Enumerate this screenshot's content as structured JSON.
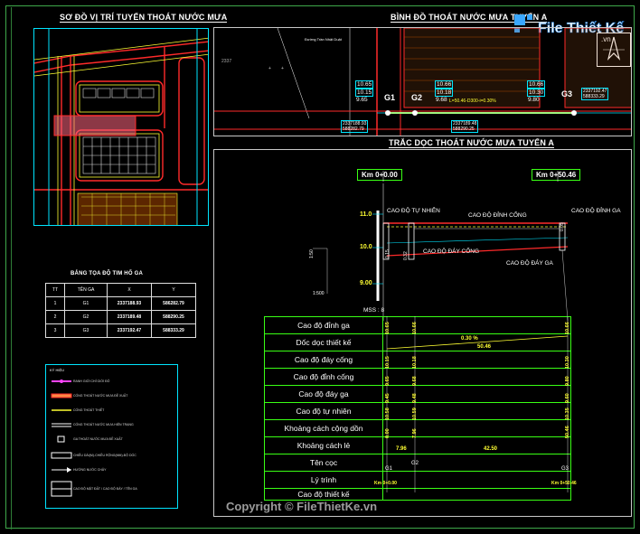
{
  "titles": {
    "location_map": "SƠ ĐỒ VỊ TRÍ TUYẾN THOÁT NƯỚC MƯA",
    "plan": "BÌNH ĐỒ THOÁT NƯỚC MƯA TUYẾN A",
    "profile": "TRẮC DỌC THOÁT NƯỚC MƯA TUYẾN A"
  },
  "coord_table": {
    "title": "BẢNG TỌA ĐỘ TIM HỐ GA",
    "headers": [
      "TT",
      "TÊN GA",
      "X",
      "Y"
    ],
    "rows": [
      [
        "1",
        "G1",
        "2337188.93",
        "586282.79"
      ],
      [
        "2",
        "G2",
        "2337189.48",
        "588290.25"
      ],
      [
        "3",
        "G3",
        "2337192.47",
        "588333.29"
      ]
    ]
  },
  "legend": {
    "title": "KÝ HIỆU",
    "items": [
      "RANH GIỚI CHỈ GIỚI ĐỎ",
      "CỐNG THOÁT NƯỚC MƯA ĐỀ XUẤT",
      "CỐNG THOÁT THIẾT",
      "CỐNG THOÁT NƯỚC MƯA HIỆN TRẠNG",
      "GA THOÁT NƯỚC MƯA ĐỀ XUẤT",
      "CHIỀU DÀI(M)-CHIỀU RỘNG(MM)-ĐỘ DỐC",
      "HƯỚNG NƯỚC CHẢY",
      "CAO ĐỘ MẶT ĐẤT / CAO ĐỘ ĐÁY / TÊN GA"
    ]
  },
  "plan": {
    "street": "Đường Trần Nhật Duật",
    "grid_label": "2337",
    "g1": {
      "name": "G1",
      "levels": [
        "10.65",
        "10.15",
        "9.65"
      ],
      "coord_x": "2337188.93",
      "coord_y": "588282.79"
    },
    "g2": {
      "name": "G2",
      "levels": [
        "10.66",
        "10.18",
        "9.68"
      ],
      "coord_x": "2337189.48",
      "coord_y": "588290.25"
    },
    "g3": {
      "name": "G3",
      "levels": [
        "10.66",
        "10.30",
        "9.80"
      ],
      "coord_x": "2337192.47",
      "coord_y": "588333.29"
    },
    "pipe_label": "L=50.46-D300-i=0.30%"
  },
  "profile": {
    "km_start": "Km 0+0.00",
    "km_end": "Km 0+50.46",
    "axis_levels": [
      "11.0",
      "10.0",
      "9.00"
    ],
    "mss": "MSS : 8",
    "scale": [
      "1:50",
      "1:500"
    ],
    "annotations": {
      "natural": "CAO ĐỘ TỰ NHIÊN",
      "pipe_top": "CAO ĐỘ ĐỈNH CỐNG",
      "ga_top": "CAO ĐỘ ĐỈNH GA",
      "pipe_bottom": "CAO ĐỘ ĐÁY CỐNG",
      "ga_bottom": "CAO ĐỘ ĐÁY GA"
    },
    "pipe_tags": [
      "0.15",
      "0.32",
      "0.05"
    ]
  },
  "data_table": {
    "rows": [
      {
        "label": "Cao độ đỉnh ga",
        "values": [
          "10.65",
          "10.66",
          "10.66"
        ]
      },
      {
        "label": "Dốc dọc thiết kế",
        "values": [
          "0.30 %",
          "50.46"
        ]
      },
      {
        "label": "Cao độ đáy cống",
        "values": [
          "10.15",
          "10.18",
          "10.30"
        ]
      },
      {
        "label": "Cao độ đỉnh cống",
        "values": [
          "9.65",
          "9.68",
          "9.80"
        ]
      },
      {
        "label": "Cao độ đáy ga",
        "values": [
          "9.45",
          "9.48",
          "9.60"
        ]
      },
      {
        "label": "Cao độ tự nhiên",
        "values": [
          "10.58",
          "10.59",
          "10.35"
        ]
      },
      {
        "label": "Khoảng cách cộng dồn",
        "values": [
          "0.00",
          "7.96",
          "50.46"
        ]
      },
      {
        "label": "Khoảng cách lẻ",
        "values": [
          "7.96",
          "42.50"
        ]
      },
      {
        "label": "Tên cọc",
        "values": [
          "G1",
          "G2",
          "G3"
        ]
      },
      {
        "label": "Lý trình",
        "values": [
          "Km 0+0.00",
          "Km 0+50.46"
        ]
      },
      {
        "label": "Cao độ thiết kế",
        "values": []
      }
    ]
  },
  "watermark": {
    "logo_text": "File Thiết Kế",
    "logo_domain": ".vn",
    "copyright": "Copyright © FileThietKe.vn"
  },
  "colors": {
    "line": "#39ff14",
    "cyan": "#00e5ff",
    "red": "#ff2a2a",
    "yellow": "#ffff33",
    "background": "#000000"
  }
}
